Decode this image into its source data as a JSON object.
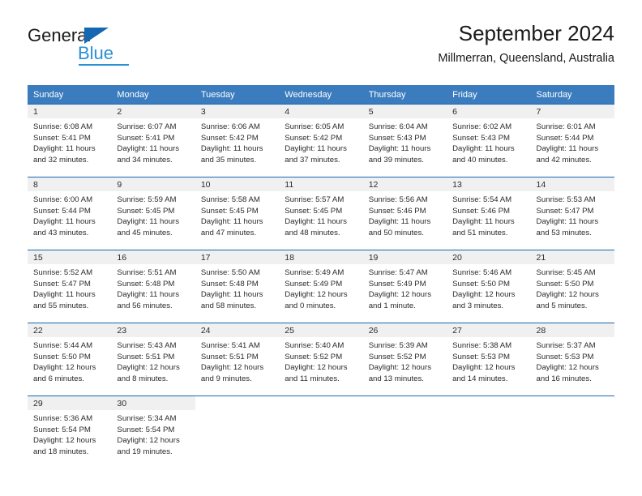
{
  "brand": {
    "name_part1": "General",
    "name_part2": "Blue",
    "logo_icon": "triangle-flag-icon",
    "accent_color": "#1667b2",
    "accent_color_light": "#2a8fd4"
  },
  "header": {
    "title": "September 2024",
    "subtitle": "Millmerran, Queensland, Australia"
  },
  "calendar": {
    "header_bg": "#3a7cbe",
    "row_divider_color": "#1667b2",
    "daynum_band_bg": "#f0f0f0",
    "weekday_headers": [
      "Sunday",
      "Monday",
      "Tuesday",
      "Wednesday",
      "Thursday",
      "Friday",
      "Saturday"
    ],
    "weeks": [
      [
        {
          "day": "1",
          "sunrise": "Sunrise: 6:08 AM",
          "sunset": "Sunset: 5:41 PM",
          "daylight_line1": "Daylight: 11 hours",
          "daylight_line2": "and 32 minutes."
        },
        {
          "day": "2",
          "sunrise": "Sunrise: 6:07 AM",
          "sunset": "Sunset: 5:41 PM",
          "daylight_line1": "Daylight: 11 hours",
          "daylight_line2": "and 34 minutes."
        },
        {
          "day": "3",
          "sunrise": "Sunrise: 6:06 AM",
          "sunset": "Sunset: 5:42 PM",
          "daylight_line1": "Daylight: 11 hours",
          "daylight_line2": "and 35 minutes."
        },
        {
          "day": "4",
          "sunrise": "Sunrise: 6:05 AM",
          "sunset": "Sunset: 5:42 PM",
          "daylight_line1": "Daylight: 11 hours",
          "daylight_line2": "and 37 minutes."
        },
        {
          "day": "5",
          "sunrise": "Sunrise: 6:04 AM",
          "sunset": "Sunset: 5:43 PM",
          "daylight_line1": "Daylight: 11 hours",
          "daylight_line2": "and 39 minutes."
        },
        {
          "day": "6",
          "sunrise": "Sunrise: 6:02 AM",
          "sunset": "Sunset: 5:43 PM",
          "daylight_line1": "Daylight: 11 hours",
          "daylight_line2": "and 40 minutes."
        },
        {
          "day": "7",
          "sunrise": "Sunrise: 6:01 AM",
          "sunset": "Sunset: 5:44 PM",
          "daylight_line1": "Daylight: 11 hours",
          "daylight_line2": "and 42 minutes."
        }
      ],
      [
        {
          "day": "8",
          "sunrise": "Sunrise: 6:00 AM",
          "sunset": "Sunset: 5:44 PM",
          "daylight_line1": "Daylight: 11 hours",
          "daylight_line2": "and 43 minutes."
        },
        {
          "day": "9",
          "sunrise": "Sunrise: 5:59 AM",
          "sunset": "Sunset: 5:45 PM",
          "daylight_line1": "Daylight: 11 hours",
          "daylight_line2": "and 45 minutes."
        },
        {
          "day": "10",
          "sunrise": "Sunrise: 5:58 AM",
          "sunset": "Sunset: 5:45 PM",
          "daylight_line1": "Daylight: 11 hours",
          "daylight_line2": "and 47 minutes."
        },
        {
          "day": "11",
          "sunrise": "Sunrise: 5:57 AM",
          "sunset": "Sunset: 5:45 PM",
          "daylight_line1": "Daylight: 11 hours",
          "daylight_line2": "and 48 minutes."
        },
        {
          "day": "12",
          "sunrise": "Sunrise: 5:56 AM",
          "sunset": "Sunset: 5:46 PM",
          "daylight_line1": "Daylight: 11 hours",
          "daylight_line2": "and 50 minutes."
        },
        {
          "day": "13",
          "sunrise": "Sunrise: 5:54 AM",
          "sunset": "Sunset: 5:46 PM",
          "daylight_line1": "Daylight: 11 hours",
          "daylight_line2": "and 51 minutes."
        },
        {
          "day": "14",
          "sunrise": "Sunrise: 5:53 AM",
          "sunset": "Sunset: 5:47 PM",
          "daylight_line1": "Daylight: 11 hours",
          "daylight_line2": "and 53 minutes."
        }
      ],
      [
        {
          "day": "15",
          "sunrise": "Sunrise: 5:52 AM",
          "sunset": "Sunset: 5:47 PM",
          "daylight_line1": "Daylight: 11 hours",
          "daylight_line2": "and 55 minutes."
        },
        {
          "day": "16",
          "sunrise": "Sunrise: 5:51 AM",
          "sunset": "Sunset: 5:48 PM",
          "daylight_line1": "Daylight: 11 hours",
          "daylight_line2": "and 56 minutes."
        },
        {
          "day": "17",
          "sunrise": "Sunrise: 5:50 AM",
          "sunset": "Sunset: 5:48 PM",
          "daylight_line1": "Daylight: 11 hours",
          "daylight_line2": "and 58 minutes."
        },
        {
          "day": "18",
          "sunrise": "Sunrise: 5:49 AM",
          "sunset": "Sunset: 5:49 PM",
          "daylight_line1": "Daylight: 12 hours",
          "daylight_line2": "and 0 minutes."
        },
        {
          "day": "19",
          "sunrise": "Sunrise: 5:47 AM",
          "sunset": "Sunset: 5:49 PM",
          "daylight_line1": "Daylight: 12 hours",
          "daylight_line2": "and 1 minute."
        },
        {
          "day": "20",
          "sunrise": "Sunrise: 5:46 AM",
          "sunset": "Sunset: 5:50 PM",
          "daylight_line1": "Daylight: 12 hours",
          "daylight_line2": "and 3 minutes."
        },
        {
          "day": "21",
          "sunrise": "Sunrise: 5:45 AM",
          "sunset": "Sunset: 5:50 PM",
          "daylight_line1": "Daylight: 12 hours",
          "daylight_line2": "and 5 minutes."
        }
      ],
      [
        {
          "day": "22",
          "sunrise": "Sunrise: 5:44 AM",
          "sunset": "Sunset: 5:50 PM",
          "daylight_line1": "Daylight: 12 hours",
          "daylight_line2": "and 6 minutes."
        },
        {
          "day": "23",
          "sunrise": "Sunrise: 5:43 AM",
          "sunset": "Sunset: 5:51 PM",
          "daylight_line1": "Daylight: 12 hours",
          "daylight_line2": "and 8 minutes."
        },
        {
          "day": "24",
          "sunrise": "Sunrise: 5:41 AM",
          "sunset": "Sunset: 5:51 PM",
          "daylight_line1": "Daylight: 12 hours",
          "daylight_line2": "and 9 minutes."
        },
        {
          "day": "25",
          "sunrise": "Sunrise: 5:40 AM",
          "sunset": "Sunset: 5:52 PM",
          "daylight_line1": "Daylight: 12 hours",
          "daylight_line2": "and 11 minutes."
        },
        {
          "day": "26",
          "sunrise": "Sunrise: 5:39 AM",
          "sunset": "Sunset: 5:52 PM",
          "daylight_line1": "Daylight: 12 hours",
          "daylight_line2": "and 13 minutes."
        },
        {
          "day": "27",
          "sunrise": "Sunrise: 5:38 AM",
          "sunset": "Sunset: 5:53 PM",
          "daylight_line1": "Daylight: 12 hours",
          "daylight_line2": "and 14 minutes."
        },
        {
          "day": "28",
          "sunrise": "Sunrise: 5:37 AM",
          "sunset": "Sunset: 5:53 PM",
          "daylight_line1": "Daylight: 12 hours",
          "daylight_line2": "and 16 minutes."
        }
      ],
      [
        {
          "day": "29",
          "sunrise": "Sunrise: 5:36 AM",
          "sunset": "Sunset: 5:54 PM",
          "daylight_line1": "Daylight: 12 hours",
          "daylight_line2": "and 18 minutes."
        },
        {
          "day": "30",
          "sunrise": "Sunrise: 5:34 AM",
          "sunset": "Sunset: 5:54 PM",
          "daylight_line1": "Daylight: 12 hours",
          "daylight_line2": "and 19 minutes."
        },
        {
          "day": "",
          "sunrise": "",
          "sunset": "",
          "daylight_line1": "",
          "daylight_line2": ""
        },
        {
          "day": "",
          "sunrise": "",
          "sunset": "",
          "daylight_line1": "",
          "daylight_line2": ""
        },
        {
          "day": "",
          "sunrise": "",
          "sunset": "",
          "daylight_line1": "",
          "daylight_line2": ""
        },
        {
          "day": "",
          "sunrise": "",
          "sunset": "",
          "daylight_line1": "",
          "daylight_line2": ""
        },
        {
          "day": "",
          "sunrise": "",
          "sunset": "",
          "daylight_line1": "",
          "daylight_line2": ""
        }
      ]
    ]
  }
}
